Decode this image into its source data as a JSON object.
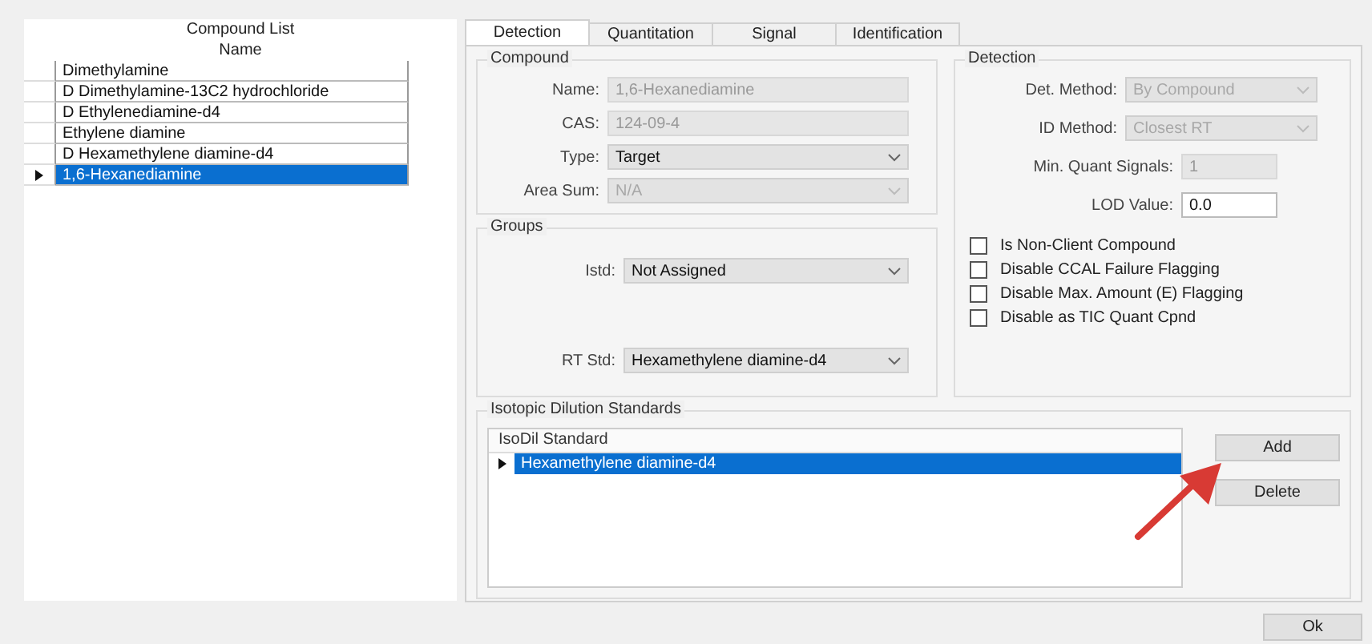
{
  "compound_list": {
    "title": "Compound List",
    "column": "Name",
    "rows": [
      {
        "name": "Dimethylamine",
        "selected": false
      },
      {
        "name": "D Dimethylamine-13C2 hydrochloride",
        "selected": false
      },
      {
        "name": "D Ethylenediamine-d4",
        "selected": false
      },
      {
        "name": "Ethylene diamine",
        "selected": false
      },
      {
        "name": "D Hexamethylene diamine-d4",
        "selected": false
      },
      {
        "name": "1,6-Hexanediamine",
        "selected": true
      }
    ]
  },
  "tabs": [
    {
      "label": "Detection",
      "selected": true
    },
    {
      "label": "Quantitation",
      "selected": false
    },
    {
      "label": "Signal",
      "selected": false
    },
    {
      "label": "Identification",
      "selected": false
    }
  ],
  "compound": {
    "title": "Compound",
    "fields": [
      {
        "label": "Name:",
        "kind": "text",
        "value": "1,6-Hexanediamine",
        "disabled": true
      },
      {
        "label": "CAS:",
        "kind": "text",
        "value": "124-09-4",
        "disabled": true
      },
      {
        "label": "Type:",
        "kind": "dropdown",
        "value": "Target",
        "disabled": false
      },
      {
        "label": "Area Sum:",
        "kind": "dropdown",
        "value": "N/A",
        "disabled": true
      }
    ]
  },
  "groups": {
    "title": "Groups",
    "fields": [
      {
        "label": "Istd:",
        "kind": "dropdown",
        "value": "Not Assigned",
        "disabled": false
      },
      {
        "label": "RT Std:",
        "kind": "dropdown",
        "value": "Hexamethylene diamine-d4",
        "disabled": false
      }
    ]
  },
  "detection": {
    "title": "Detection",
    "fields": [
      {
        "label": "Det. Method:",
        "kind": "dropdown",
        "value": "By Compound",
        "disabled": true
      },
      {
        "label": "ID Method:",
        "kind": "dropdown",
        "value": "Closest RT",
        "disabled": true
      },
      {
        "label": "Min. Quant Signals:",
        "kind": "text",
        "value": "1",
        "disabled": true
      },
      {
        "label": "LOD Value:",
        "kind": "text",
        "value": "0.0",
        "disabled": false
      }
    ],
    "checkboxes": [
      {
        "label": "Is Non-Client Compound",
        "checked": false
      },
      {
        "label": "Disable CCAL Failure Flagging",
        "checked": false
      },
      {
        "label": "Disable Max. Amount (E) Flagging",
        "checked": false
      },
      {
        "label": "Disable as TIC Quant Cpnd",
        "checked": false
      }
    ]
  },
  "isotopic_dilution": {
    "title": "Isotopic Dilution Standards",
    "column": "IsoDil Standard",
    "rows": [
      {
        "name": "Hexamethylene diamine-d4",
        "selected": true
      }
    ],
    "buttons": [
      "Add",
      "Delete"
    ]
  },
  "ok_button": "Ok"
}
